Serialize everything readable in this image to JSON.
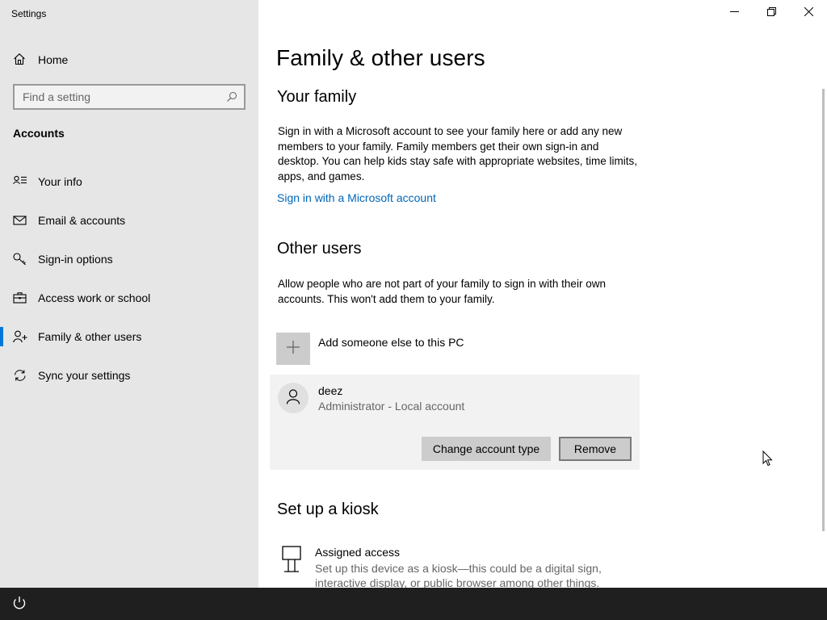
{
  "app": {
    "title": "Settings"
  },
  "sidebar": {
    "home_label": "Home",
    "search_placeholder": "Find a setting",
    "section_heading": "Accounts",
    "items": [
      {
        "label": "Your info",
        "icon": "user-card-icon"
      },
      {
        "label": "Email & accounts",
        "icon": "mail-icon"
      },
      {
        "label": "Sign-in options",
        "icon": "key-icon"
      },
      {
        "label": "Access work or school",
        "icon": "briefcase-icon"
      },
      {
        "label": "Family & other users",
        "icon": "add-user-icon",
        "selected": true
      },
      {
        "label": "Sync your settings",
        "icon": "sync-icon"
      }
    ]
  },
  "main": {
    "title": "Family & other users",
    "your_family": {
      "heading": "Your family",
      "description": "Sign in with a Microsoft account to see your family here or add any new members to your family. Family members get their own sign-in and desktop. You can help kids stay safe with appropriate websites, time limits, apps, and games.",
      "link": "Sign in with a Microsoft account"
    },
    "other_users": {
      "heading": "Other users",
      "description": "Allow people who are not part of your family to sign in with their own accounts. This won't add them to your family.",
      "add_label": "Add someone else to this PC",
      "user": {
        "name": "deez",
        "type": "Administrator - Local account",
        "change_button": "Change account type",
        "remove_button": "Remove"
      }
    },
    "kiosk": {
      "heading": "Set up a kiosk",
      "item_title": "Assigned access",
      "item_desc": "Set up this device as a kiosk—this could be a digital sign, interactive display, or public browser among other things."
    }
  },
  "colors": {
    "accent": "#0078d7",
    "link": "#0067b8",
    "sidebar_bg": "#e6e6e6",
    "taskbar_bg": "#1f1f1f"
  }
}
